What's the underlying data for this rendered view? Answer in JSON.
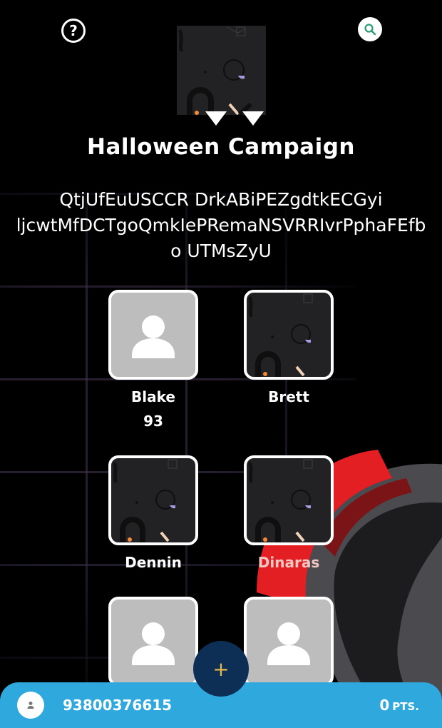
{
  "header": {
    "help_icon": "question-circle-icon",
    "search_icon": "search-icon",
    "accent_color": "#2e9d77"
  },
  "campaign": {
    "title": "Halloween Campaign",
    "description_lines": [
      "QtjUfEuUSCCR DrkABiPEZgdtkECGyi",
      "ljcwtMfDCTgoQmkIePRemaNSVRRIvrPphaFEfb",
      "o UTMsZyU"
    ]
  },
  "members": [
    {
      "name": "Blake",
      "score": "93",
      "avatar": "default"
    },
    {
      "name": "Brett",
      "score": "",
      "avatar": "pattern"
    },
    {
      "name": "Dennin",
      "score": "",
      "avatar": "pattern"
    },
    {
      "name": "Dinaras",
      "score": "",
      "avatar": "pattern"
    },
    {
      "name": "",
      "score": "",
      "avatar": "default"
    },
    {
      "name": "",
      "score": "",
      "avatar": "default"
    }
  ],
  "fab": {
    "label": "+"
  },
  "bottom_bar": {
    "user_id": "93800376615",
    "points_value": "0",
    "points_unit": "PTS.",
    "color": "#2fa8de"
  }
}
